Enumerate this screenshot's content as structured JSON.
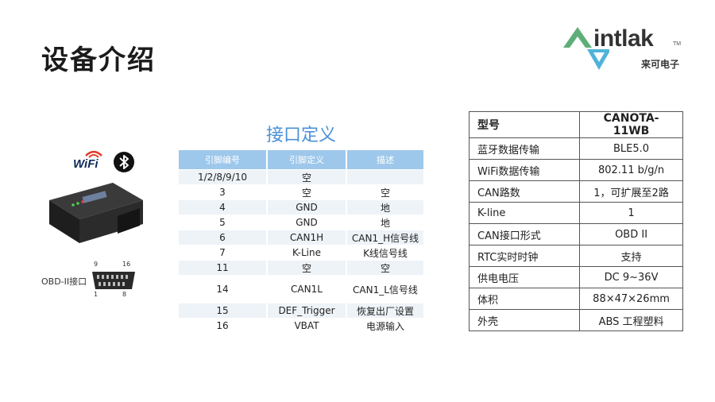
{
  "page": {
    "title": "设备介绍"
  },
  "logo": {
    "word": "intlak",
    "tm": "TM",
    "cn": "来可电子"
  },
  "left": {
    "wifi_text": "WiFi",
    "obd_label": "OBD-II接口",
    "pin_numbers": {
      "top_left": "9",
      "top_right": "16",
      "bottom_left": "1",
      "bottom_right": "8"
    }
  },
  "pin_table": {
    "title": "接口定义",
    "headers": [
      "引脚编号",
      "引脚定义",
      "描述"
    ],
    "rows": [
      [
        "1/2/8/9/10",
        "空",
        ""
      ],
      [
        "3",
        "空",
        "空"
      ],
      [
        "4",
        "GND",
        "地"
      ],
      [
        "5",
        "GND",
        "地"
      ],
      [
        "6",
        "CAN1H",
        "CAN1_H信号线"
      ],
      [
        "7",
        "K-Line",
        "K线信号线"
      ],
      [
        "11",
        "空",
        "空"
      ],
      [
        "14",
        "CAN1L",
        "CAN1_L信号线"
      ],
      [
        "15",
        "DEF_Trigger",
        "恢复出厂设置"
      ],
      [
        "16",
        "VBAT",
        "电源输入"
      ]
    ]
  },
  "spec_table": {
    "rows": [
      [
        "型号",
        "CANOTA-11WB"
      ],
      [
        "蓝牙数据传输",
        "BLE5.0"
      ],
      [
        "WiFi数据传输",
        "802.11 b/g/n"
      ],
      [
        "CAN路数",
        "1，可扩展至2路"
      ],
      [
        "K-line",
        "1"
      ],
      [
        "CAN接口形式",
        "OBD II"
      ],
      [
        "RTC实时时钟",
        "支持"
      ],
      [
        "供电电压",
        "DC 9~36V"
      ],
      [
        "体积",
        "88×47×26mm"
      ],
      [
        "外壳",
        "ABS 工程塑料"
      ]
    ]
  },
  "colors": {
    "accent": "#4a90d9",
    "header_bg": "#9ec8eb",
    "logo_green": "#5fae7a",
    "logo_blue": "#4fb3d9"
  }
}
